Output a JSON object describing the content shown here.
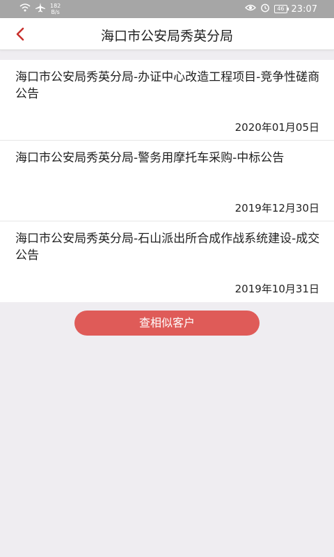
{
  "status_bar": {
    "speed_value": "182",
    "speed_unit": "B/s",
    "battery": "46",
    "time": "23:07",
    "icons": [
      "wifi-icon",
      "airplane-icon",
      "eye-icon",
      "alarm-icon",
      "battery-icon"
    ]
  },
  "header": {
    "title": "海口市公安局秀英分局",
    "back_icon": "chevron-left-icon",
    "accent_color": "#c8302c"
  },
  "notices": [
    {
      "title": "海口市公安局秀英分局-办证中心改造工程项目-竞争性磋商公告",
      "date": "2020年01月05日"
    },
    {
      "title": "海口市公安局秀英分局-警务用摩托车采购-中标公告",
      "date": "2019年12月30日"
    },
    {
      "title": "海口市公安局秀英分局-石山派出所合成作战系统建设-成交公告",
      "date": "2019年10月31日"
    }
  ],
  "actions": {
    "similar_button_label": "查相似客户",
    "button_color": "#df5b58"
  }
}
